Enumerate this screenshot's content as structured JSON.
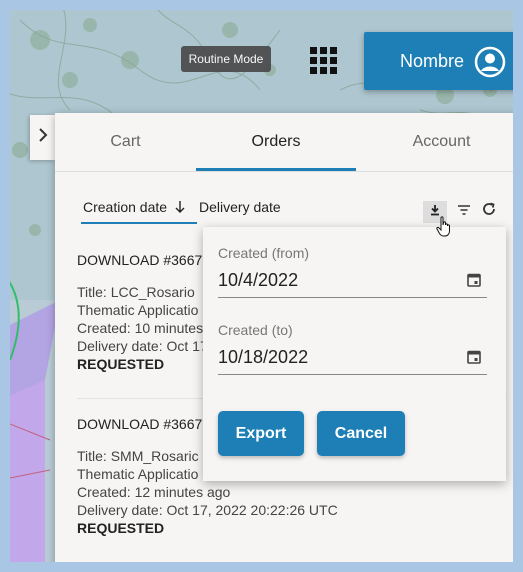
{
  "header": {
    "mode_label": "Routine Mode",
    "apps_icon": "apps-grid-icon",
    "user_label": "Nombre",
    "user_icon": "account-circle-icon"
  },
  "panel": {
    "expander_icon": "chevron-right-icon",
    "tabs": [
      {
        "label": "Cart",
        "active": false
      },
      {
        "label": "Orders",
        "active": true
      },
      {
        "label": "Account",
        "active": false
      }
    ],
    "sort": {
      "creation_label": "Creation date",
      "creation_icon": "arrow-down",
      "delivery_label": "Delivery date",
      "download_icon": "download-icon",
      "filter_icon": "filter-icon",
      "refresh_icon": "refresh-icon"
    },
    "orders": [
      {
        "id": "DOWNLOAD #3667",
        "title": "Title: LCC_Rosario",
        "application": "Thematic Applicatio",
        "created": "Created: 10 minutes",
        "delivery": "Delivery date: Oct 17",
        "status": "REQUESTED"
      },
      {
        "id": "DOWNLOAD #3667",
        "title": "Title: SMM_Rosaric",
        "application": "Thematic Applicatio",
        "created": "Created: 12 minutes ago",
        "delivery": "Delivery date: Oct 17, 2022 20:22:26 UTC",
        "status": "REQUESTED"
      }
    ]
  },
  "export_popup": {
    "from_label": "Created (from)",
    "from_value": "10/4/2022",
    "to_label": "Created (to)",
    "to_value": "10/18/2022",
    "export_label": "Export",
    "cancel_label": "Cancel"
  },
  "colors": {
    "accent": "#1d7fb6",
    "panel_bg": "#f7f5f3",
    "frame": "#a9c6e5"
  }
}
